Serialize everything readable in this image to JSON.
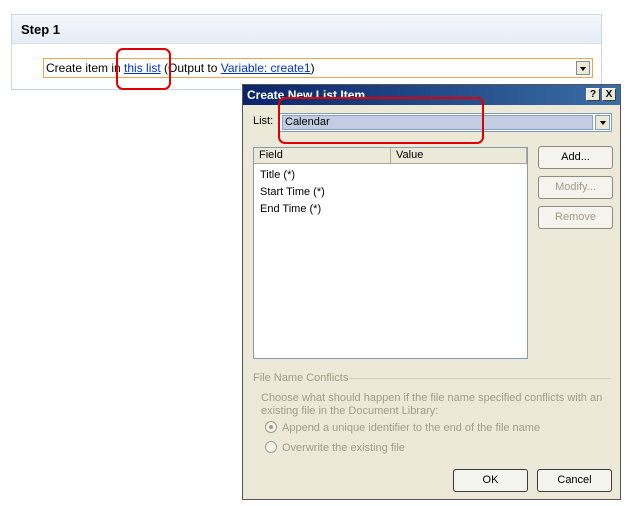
{
  "step": {
    "title": "Step 1",
    "action": {
      "prefix": "Create item in ",
      "list_link": "this list",
      "middle": " (Output to ",
      "variable_link": "Variable: create1",
      "suffix": ")"
    }
  },
  "dialog": {
    "title": "Create New List Item",
    "help_btn": "?",
    "close_btn": "X",
    "list_label": "List:",
    "list_value": "Calendar",
    "columns": [
      "Field",
      "Value"
    ],
    "fields": [
      "Title (*)",
      "Start Time (*)",
      "End Time (*)"
    ],
    "buttons": {
      "add": "Add...",
      "modify": "Modify...",
      "remove": "Remove"
    },
    "conflicts": {
      "group_label": "File Name Conflicts",
      "description": "Choose what should happen if the file name specified conflicts with an existing file in the Document Library:",
      "options": [
        "Append a unique identifier to the end of the file name",
        "Overwrite the existing file"
      ]
    },
    "ok": "OK",
    "cancel": "Cancel"
  },
  "colors": {
    "highlight": "#e00000",
    "titlebar": "#0a246a",
    "link": "#0033cc"
  }
}
